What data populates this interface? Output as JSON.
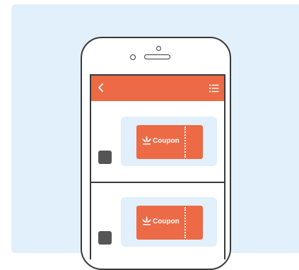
{
  "colors": {
    "background_panel": "#e1f0fa",
    "app_bar": "#ec6a45",
    "coupon": "#ec6a45",
    "avatar": "#555555",
    "phone_outline": "#3a3a3a"
  },
  "app_bar": {
    "back_icon": "chevron-left-icon",
    "menu_icon": "list-menu-icon"
  },
  "messages": [
    {
      "coupon_label": "Coupon",
      "coupon_logo": "lotus-logo-icon"
    },
    {
      "coupon_label": "Coupon",
      "coupon_logo": "lotus-logo-icon"
    }
  ]
}
